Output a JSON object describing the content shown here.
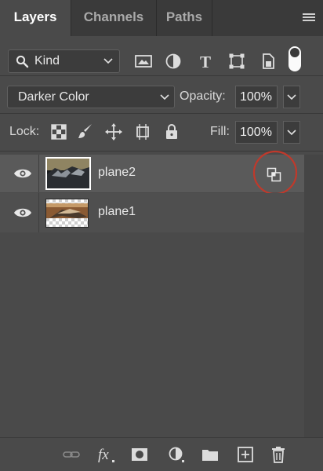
{
  "tabs": [
    {
      "label": "Layers",
      "active": true
    },
    {
      "label": "Channels",
      "active": false
    },
    {
      "label": "Paths",
      "active": false
    }
  ],
  "panel_menu_icon": "hamburger-menu-icon",
  "filter": {
    "kind_label": "Kind",
    "kind_icon": "search-icon",
    "filter_icons": [
      "image-filter-icon",
      "adjustment-filter-icon",
      "type-filter-icon",
      "shape-filter-icon",
      "smart-object-filter-icon"
    ],
    "filter_toggle": "on"
  },
  "blend": {
    "mode": "Darker Color",
    "opacity_label": "Opacity:",
    "opacity_value": "100%"
  },
  "lock": {
    "label": "Lock:",
    "icons": [
      "lock-transparent-pixels-icon",
      "lock-image-pixels-icon",
      "lock-position-icon",
      "lock-artboard-icon",
      "lock-all-icon"
    ],
    "fill_label": "Fill:",
    "fill_value": "100%"
  },
  "layers": [
    {
      "name": "plane2",
      "selected": true,
      "visible": true,
      "badge": "blend-if-icon"
    },
    {
      "name": "plane1",
      "selected": false,
      "visible": true
    }
  ],
  "annotation_color": "#c0392b",
  "footer_icons": [
    "link-layers-icon",
    "fx-icon",
    "add-mask-icon",
    "new-adjustment-icon",
    "new-group-icon",
    "new-layer-icon",
    "trash-icon"
  ]
}
